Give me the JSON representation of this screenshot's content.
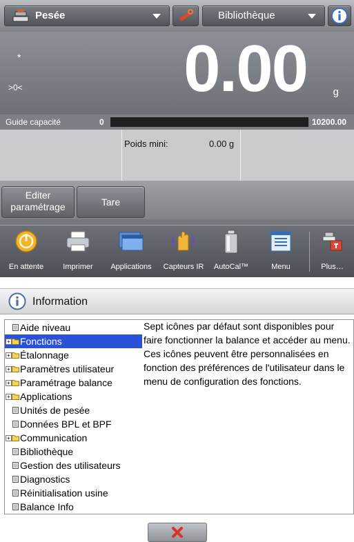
{
  "topbar": {
    "mode_label": "Pesée",
    "library_label": "Bibliothèque"
  },
  "display": {
    "weight": "0.00",
    "unit": "g",
    "stability_mark": "*",
    "zero_indicator": ">0<"
  },
  "capacity_guide": {
    "label": "Guide capacité",
    "min": "0",
    "max": "10200.00",
    "fill_fraction": 0
  },
  "info_panel": {
    "min_weight_label": "Poids mini:",
    "min_weight_value": "0.00 g"
  },
  "actions": {
    "edit_settings": "Editer paramétrage",
    "tare": "Tare"
  },
  "toolbar": [
    {
      "label": "En attente",
      "icon": "standby-icon"
    },
    {
      "label": "Imprimer",
      "icon": "printer-icon"
    },
    {
      "label": "Applications",
      "icon": "applications-icon"
    },
    {
      "label": "Capteurs IR",
      "icon": "ir-sensor-icon"
    },
    {
      "label": "AutoCal™",
      "icon": "autocal-weight-icon"
    },
    {
      "label": "Menu",
      "icon": "menu-icon"
    },
    {
      "label": "Plus…",
      "icon": "more-icon"
    }
  ],
  "info_dialog": {
    "title": "Information",
    "tree": [
      {
        "label": "Aide niveau",
        "type": "page",
        "expandable": false,
        "selected": false
      },
      {
        "label": "Fonctions",
        "type": "folder",
        "expandable": true,
        "selected": true
      },
      {
        "label": "Étalonnage",
        "type": "folder",
        "expandable": true,
        "selected": false
      },
      {
        "label": "Paramètres utilisateur",
        "type": "folder",
        "expandable": true,
        "selected": false
      },
      {
        "label": "Paramétrage balance",
        "type": "folder",
        "expandable": true,
        "selected": false
      },
      {
        "label": "Applications",
        "type": "folder",
        "expandable": true,
        "selected": false
      },
      {
        "label": "Unités de pesée",
        "type": "page",
        "expandable": false,
        "selected": false
      },
      {
        "label": "Données BPL et BPF",
        "type": "page",
        "expandable": false,
        "selected": false
      },
      {
        "label": "Communication",
        "type": "folder",
        "expandable": true,
        "selected": false
      },
      {
        "label": "Bibliothèque",
        "type": "page",
        "expandable": false,
        "selected": false
      },
      {
        "label": "Gestion des utilisateurs",
        "type": "page",
        "expandable": false,
        "selected": false
      },
      {
        "label": "Diagnostics",
        "type": "page",
        "expandable": false,
        "selected": false
      },
      {
        "label": "Réinitialisation usine",
        "type": "page",
        "expandable": false,
        "selected": false
      },
      {
        "label": "Balance Info",
        "type": "page",
        "expandable": false,
        "selected": false
      }
    ],
    "description": "Sept icônes par défaut sont disponibles pour faire fonctionner la balance et accéder au menu. Ces icônes peuvent être personnalisées en fonction des préférences de l'utilisateur dans le menu de configuration des fonctions."
  },
  "colors": {
    "selection": "#2a52d8",
    "close_icon": "#d8322f",
    "info_accent": "#3a6ec9"
  }
}
